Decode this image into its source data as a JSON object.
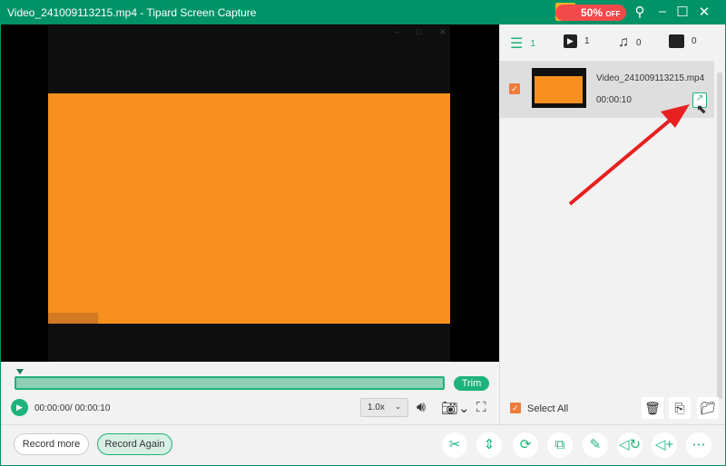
{
  "window": {
    "title": "Video_241009113215.mp4  -  Tipard Screen Capture",
    "promo": "50%",
    "promo_suffix": "OFF"
  },
  "tabs": [
    {
      "icon": "list-icon",
      "count": "1"
    },
    {
      "icon": "video-icon",
      "count": "1"
    },
    {
      "icon": "music-icon",
      "count": "0"
    },
    {
      "icon": "image-icon",
      "count": "0"
    }
  ],
  "files": [
    {
      "name": "Video_241009113215.mp4",
      "duration": "00:00:10",
      "checked": true
    }
  ],
  "player": {
    "time": "00:00:00/ 00:00:10",
    "speed": "1.0x",
    "trim_label": "Trim",
    "progress": 0
  },
  "select_all": "Select All",
  "buttons": {
    "record_more": "Record more",
    "record_again": "Record Again"
  },
  "accent": "#1db37a"
}
